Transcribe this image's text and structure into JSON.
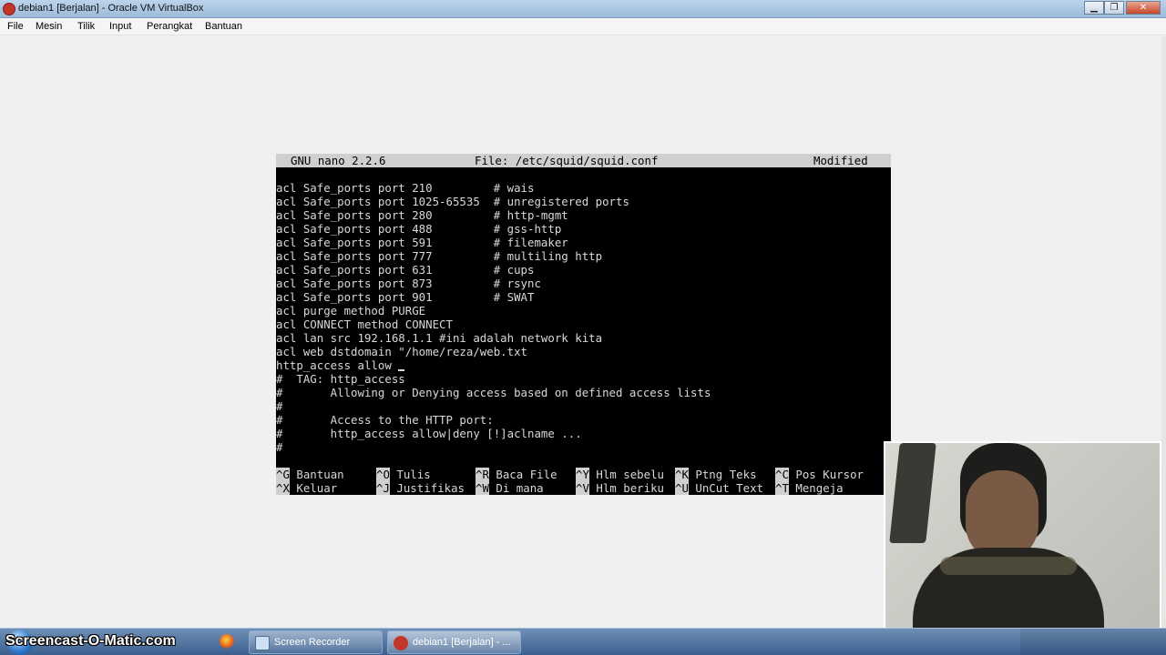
{
  "window": {
    "title": "debian1 [Berjalan] - Oracle VM VirtualBox",
    "min_icon": "minimize-icon",
    "max_icon": "maximize-icon",
    "close_icon": "close-icon"
  },
  "menu": [
    "File",
    "Mesin",
    "Tilik",
    "Input",
    "Perangkat",
    "Bantuan"
  ],
  "nano": {
    "version": "GNU nano 2.2.6",
    "file": "File: /etc/squid/squid.conf",
    "status": "Modified",
    "lines": [
      "acl Safe_ports port 210         # wais",
      "acl Safe_ports port 1025-65535  # unregistered ports",
      "acl Safe_ports port 280         # http-mgmt",
      "acl Safe_ports port 488         # gss-http",
      "acl Safe_ports port 591         # filemaker",
      "acl Safe_ports port 777         # multiling http",
      "acl Safe_ports port 631         # cups",
      "acl Safe_ports port 873         # rsync",
      "acl Safe_ports port 901         # SWAT",
      "acl purge method PURGE",
      "acl CONNECT method CONNECT",
      "acl lan src 192.168.1.1 #ini adalah network kita",
      "acl web dstdomain \"/home/reza/web.txt",
      "http_access allow ",
      "#  TAG: http_access",
      "#       Allowing or Denying access based on defined access lists",
      "#",
      "#       Access to the HTTP port:",
      "#       http_access allow|deny [!]aclname ...",
      "#"
    ],
    "shortcuts_row1": [
      {
        "key": "^G",
        "label": "Bantuan"
      },
      {
        "key": "^O",
        "label": "Tulis"
      },
      {
        "key": "^R",
        "label": "Baca File"
      },
      {
        "key": "^Y",
        "label": "Hlm sebelu"
      },
      {
        "key": "^K",
        "label": "Ptng Teks"
      },
      {
        "key": "^C",
        "label": "Pos Kursor"
      }
    ],
    "shortcuts_row2": [
      {
        "key": "^X",
        "label": "Keluar"
      },
      {
        "key": "^J",
        "label": "Justifikas"
      },
      {
        "key": "^W",
        "label": "Di mana"
      },
      {
        "key": "^V",
        "label": "Hlm beriku"
      },
      {
        "key": "^U",
        "label": "UnCut Text"
      },
      {
        "key": "^T",
        "label": "Mengeja"
      }
    ]
  },
  "taskbar": {
    "watermark": "Screencast-O-Matic.com",
    "start_icon": "windows-start-icon",
    "firefox_icon": "firefox-icon",
    "buttons": [
      {
        "label": "Screen Recorder",
        "icon": "screen-recorder-icon"
      },
      {
        "label": "debian1 [Berjalan] - ...",
        "icon": "virtualbox-icon"
      }
    ]
  },
  "colors": {
    "terminal_bg": "#000000",
    "terminal_fg": "#d8d8d8",
    "nano_bar_bg": "#cfcfcf",
    "titlebar": "#9dbbdb",
    "taskbar": "#3b5f8e"
  }
}
